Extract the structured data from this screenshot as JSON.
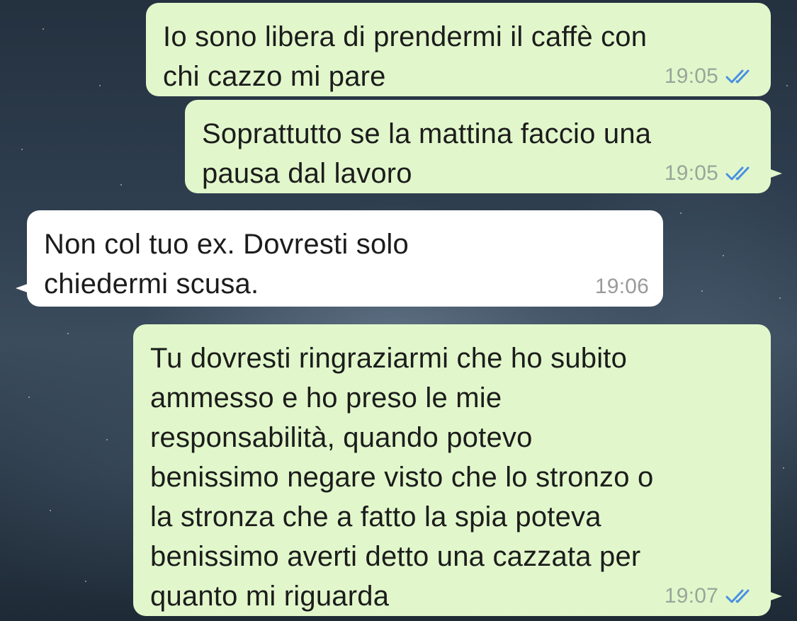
{
  "messages": [
    {
      "text": "Io sono libera di prendermi il caffè con\nchi cazzo mi pare",
      "time": "19:05",
      "direction": "outgoing",
      "status_icon": "double-check-icon"
    },
    {
      "text": "Soprattutto se la mattina faccio una\npausa dal lavoro",
      "time": "19:05",
      "direction": "outgoing",
      "status_icon": "double-check-icon"
    },
    {
      "text": "Non col tuo ex. Dovresti solo\nchiedermi scusa.",
      "time": "19:06",
      "direction": "incoming"
    },
    {
      "text": "Tu dovresti ringraziarmi che ho subito\nammesso e ho preso le mie\nresponsabilità, quando potevo\nbenissimo negare visto che lo stronzo o\nla stronza che a fatto la spia poteva\nbenissimo averti detto una cazzata per\nquanto mi riguarda",
      "time": "19:07",
      "direction": "outgoing",
      "status_icon": "double-check-icon"
    }
  ],
  "colors": {
    "outgoing_bubble": "#e1f7cb",
    "incoming_bubble": "#ffffff",
    "read_ticks": "#4a90e2"
  }
}
